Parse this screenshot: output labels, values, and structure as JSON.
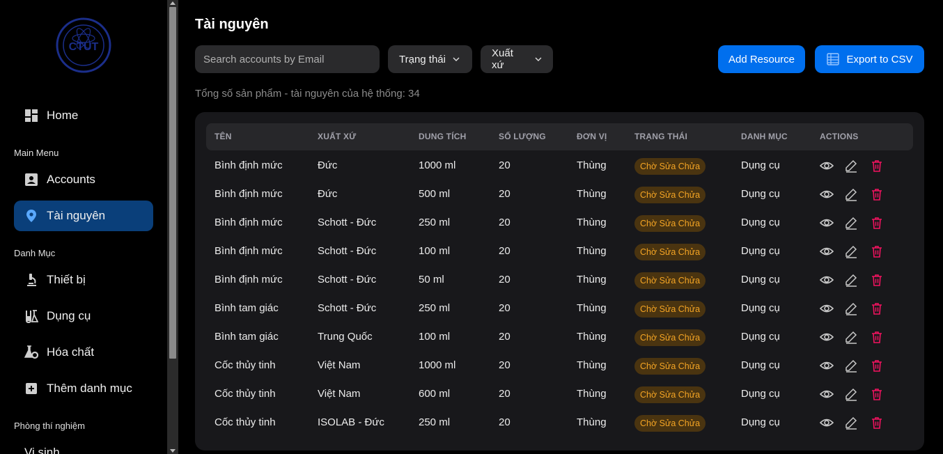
{
  "sidebar": {
    "logo_text": "CTUT",
    "home": "Home",
    "main_menu_label": "Main Menu",
    "accounts": "Accounts",
    "resources": "Tài nguyên",
    "category_label": "Danh Mục",
    "devices": "Thiết bị",
    "tools": "Dụng cụ",
    "chemicals": "Hóa chất",
    "add_category": "Thêm danh mục",
    "lab_label": "Phòng thí nghiệm",
    "microbio": "Vi sinh"
  },
  "page": {
    "title": "Tài nguyên",
    "search_placeholder": "Search accounts by Email",
    "filter_status": "Trạng thái",
    "filter_origin": "Xuất xứ",
    "add_button": "Add Resource",
    "export_button": "Export to CSV",
    "total_text": "Tổng số sản phẩm - tài nguyên của hệ thống: 34"
  },
  "table": {
    "headers": [
      "TÊN",
      "XUẤT XỨ",
      "DUNG TÍCH",
      "SỐ LƯỢNG",
      "ĐƠN VỊ",
      "TRẠNG THÁI",
      "DANH MỤC",
      "ACTIONS"
    ],
    "rows": [
      [
        "Bình định mức",
        "Đức",
        "1000 ml",
        "20",
        "Thùng",
        "Chờ Sửa Chửa",
        "Dụng cụ"
      ],
      [
        "Bình định mức",
        "Đức",
        "500 ml",
        "20",
        "Thùng",
        "Chờ Sửa Chửa",
        "Dụng cụ"
      ],
      [
        "Bình định mức",
        "Schott - Đức",
        "250 ml",
        "20",
        "Thùng",
        "Chờ Sửa Chửa",
        "Dụng cụ"
      ],
      [
        "Bình định mức",
        "Schott - Đức",
        "100 ml",
        "20",
        "Thùng",
        "Chờ Sửa Chửa",
        "Dụng cụ"
      ],
      [
        "Bình định mức",
        "Schott - Đức",
        "50 ml",
        "20",
        "Thùng",
        "Chờ Sửa Chửa",
        "Dụng cụ"
      ],
      [
        "Bình tam giác",
        "Schott - Đức",
        "250 ml",
        "20",
        "Thùng",
        "Chờ Sửa Chửa",
        "Dụng cụ"
      ],
      [
        "Bình tam giác",
        "Trung Quốc",
        "100 ml",
        "20",
        "Thùng",
        "Chờ Sửa Chửa",
        "Dụng cụ"
      ],
      [
        "Cốc thủy tinh",
        "Việt Nam",
        "1000 ml",
        "20",
        "Thùng",
        "Chờ Sửa Chửa",
        "Dụng cụ"
      ],
      [
        "Cốc thủy tinh",
        "Việt Nam",
        "600 ml",
        "20",
        "Thùng",
        "Chờ Sửa Chửa",
        "Dụng cụ"
      ],
      [
        "Cốc thủy tinh",
        "ISOLAB - Đức",
        "250 ml",
        "20",
        "Thùng",
        "Chờ Sửa Chửa",
        "Dụng cụ"
      ]
    ]
  },
  "colors": {
    "accent": "#006fee",
    "active_nav": "#0a3f7a",
    "warning_chip_text": "#f5a524",
    "danger": "#f31260"
  }
}
